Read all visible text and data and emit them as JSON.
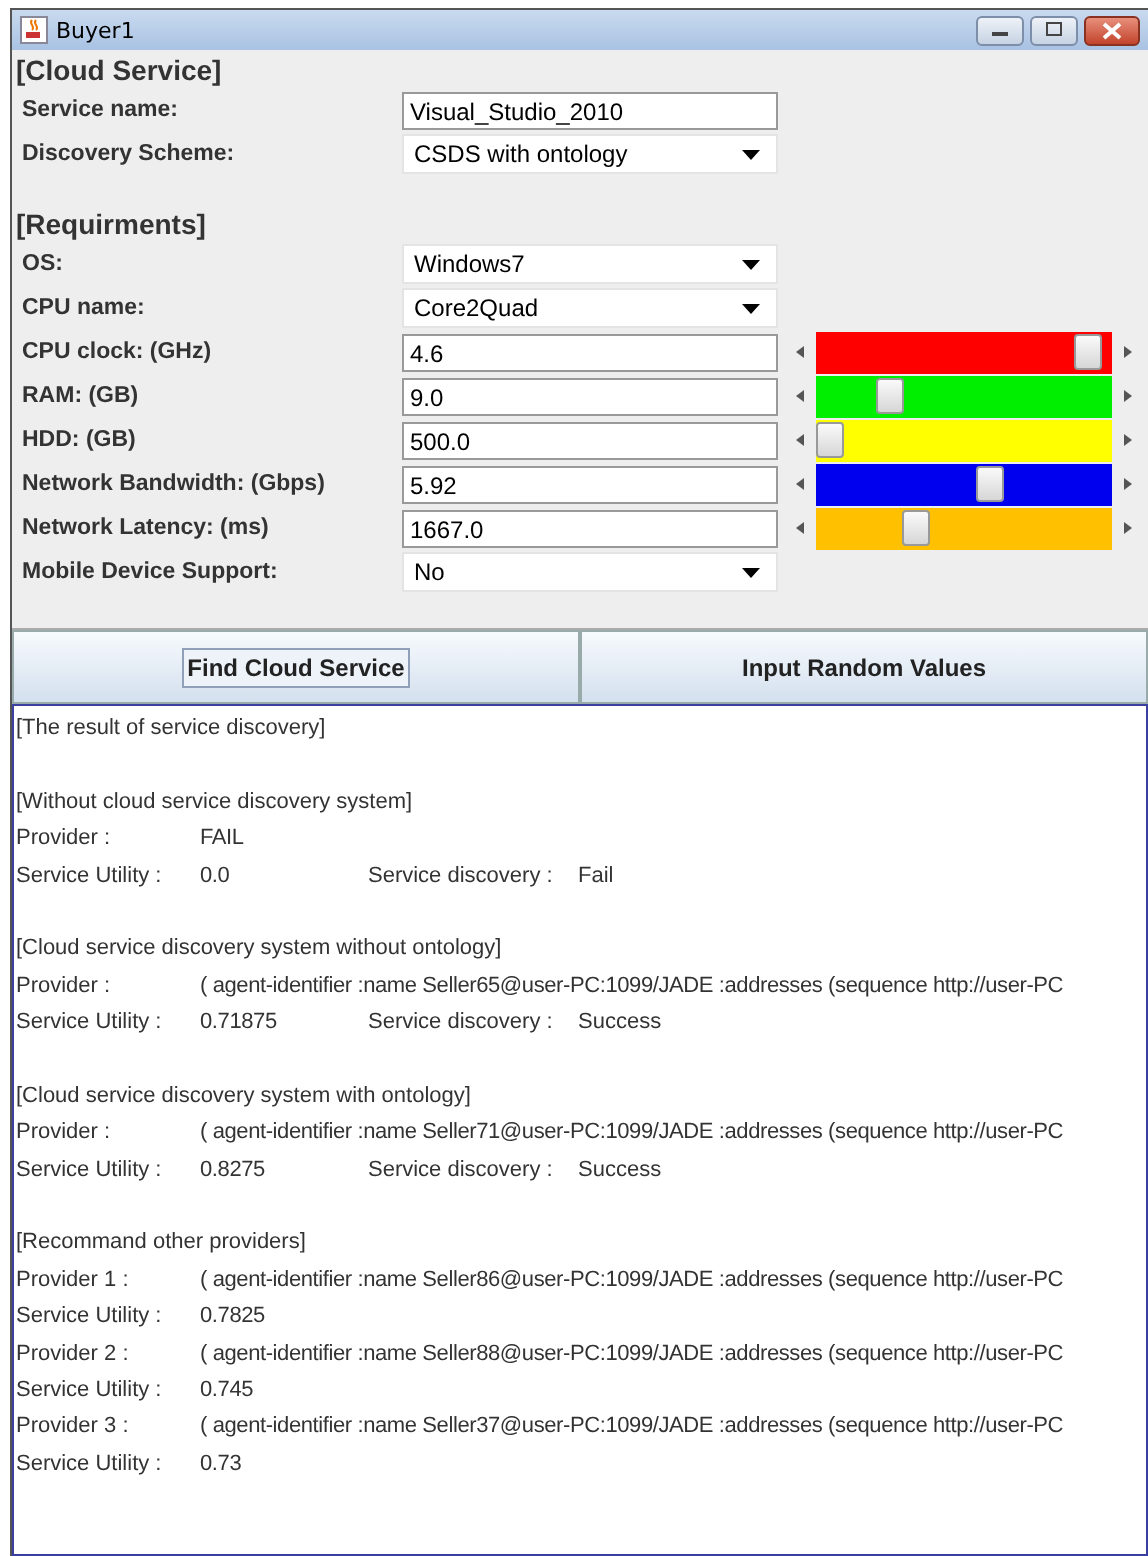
{
  "window": {
    "title": "Buyer1"
  },
  "cloud_service": {
    "heading": "[Cloud Service]",
    "fields": [
      {
        "kind": "text",
        "label": "Service name:",
        "value": "Visual_Studio_2010"
      },
      {
        "kind": "dropdown",
        "label": "Discovery Scheme:",
        "value": "CSDS with ontology"
      }
    ]
  },
  "requirements": {
    "heading": "[Requirments]",
    "fields": [
      {
        "kind": "dropdown",
        "label": "OS:",
        "value": "Windows7"
      },
      {
        "kind": "dropdown",
        "label": "CPU name:",
        "value": "Core2Quad"
      },
      {
        "kind": "slider",
        "label": "CPU clock: (GHz)",
        "value": "4.6",
        "level": 0.92,
        "color": "#ff0000"
      },
      {
        "kind": "slider",
        "label": "RAM: (GB)",
        "value": "9.0",
        "level": 0.25,
        "color": "#00ee00"
      },
      {
        "kind": "slider",
        "label": "HDD: (GB)",
        "value": "500.0",
        "level": 0.05,
        "color": "#ffff00"
      },
      {
        "kind": "slider",
        "label": "Network Bandwidth: (Gbps)",
        "value": "5.92",
        "level": 0.59,
        "color": "#0000ee"
      },
      {
        "kind": "slider",
        "label": "Network Latency: (ms)",
        "value": "1667.0",
        "level": 0.34,
        "color": "#ffc000"
      },
      {
        "kind": "dropdown",
        "label": "Mobile Device Support:",
        "value": "No"
      }
    ]
  },
  "buttons": [
    {
      "label": "Find Cloud Service",
      "focused": true
    },
    {
      "label": "Input Random Values",
      "focused": false
    }
  ],
  "output": {
    "lines": [
      {
        "kind": "text",
        "text": "[The result of service discovery]"
      },
      {
        "kind": "blank"
      },
      {
        "kind": "text",
        "text": "[Without cloud service discovery system]"
      },
      {
        "kind": "pair",
        "label": "Provider :",
        "value": "FAIL"
      },
      {
        "kind": "pair2",
        "label": "Service Utility :",
        "value": "0.0",
        "label2": "Service discovery :",
        "value2": "Fail"
      },
      {
        "kind": "blank"
      },
      {
        "kind": "text",
        "text": "[Cloud service discovery system without ontology]"
      },
      {
        "kind": "pair",
        "label": "Provider :",
        "value": "( agent-identifier :name Seller65@user-PC:1099/JADE  :addresses (sequence http://user-PC"
      },
      {
        "kind": "pair2",
        "label": "Service Utility :",
        "value": "0.71875",
        "label2": "Service discovery :",
        "value2": "Success"
      },
      {
        "kind": "blank"
      },
      {
        "kind": "text",
        "text": "[Cloud service discovery system with ontology]"
      },
      {
        "kind": "pair",
        "label": "Provider :",
        "value": "( agent-identifier :name Seller71@user-PC:1099/JADE  :addresses (sequence http://user-PC"
      },
      {
        "kind": "pair2",
        "label": "Service Utility :",
        "value": "0.8275",
        "label2": "Service discovery :",
        "value2": "Success"
      },
      {
        "kind": "blank"
      },
      {
        "kind": "text",
        "text": "[Recommand other providers]"
      },
      {
        "kind": "pair",
        "label": "Provider 1 :",
        "value": "( agent-identifier :name Seller86@user-PC:1099/JADE  :addresses (sequence http://user-PC"
      },
      {
        "kind": "pair",
        "label": "Service Utility :",
        "value": "0.7825"
      },
      {
        "kind": "pair",
        "label": "Provider 2 :",
        "value": "( agent-identifier :name Seller88@user-PC:1099/JADE  :addresses (sequence http://user-PC"
      },
      {
        "kind": "pair",
        "label": "Service Utility :",
        "value": "0.745"
      },
      {
        "kind": "pair",
        "label": "Provider 3 :",
        "value": "( agent-identifier :name Seller37@user-PC:1099/JADE  :addresses (sequence http://user-PC"
      },
      {
        "kind": "pair",
        "label": "Service Utility :",
        "value": "0.73"
      }
    ]
  }
}
